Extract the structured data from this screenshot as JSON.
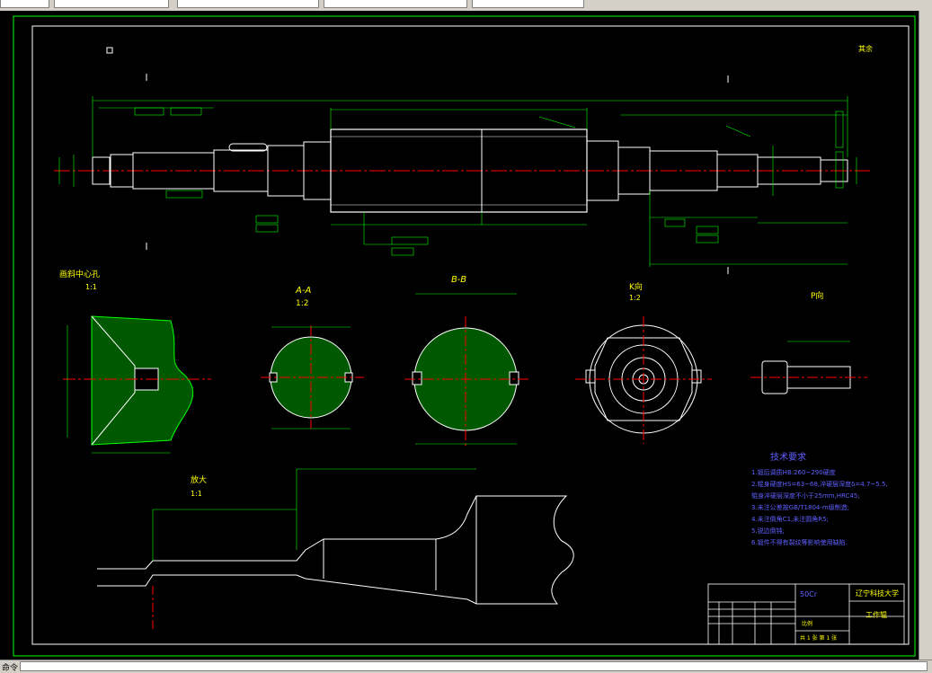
{
  "tabs": [
    {
      "label": "",
      "active": false
    },
    {
      "label": "",
      "active": false
    },
    {
      "label": "",
      "active": false
    },
    {
      "label": "",
      "active": false
    },
    {
      "label": "",
      "active": false
    }
  ],
  "status": {
    "prompt": "命令:"
  },
  "drawing": {
    "sections": {
      "center_hole": "画斜中心孔",
      "center_hole_scale": "1:1",
      "section_aa": "A-A",
      "section_aa_scale": "1:2",
      "section_bb": "B-B",
      "view_k": "K向",
      "view_k_scale": "1:2",
      "view_p": "P向",
      "enlarge": "放大",
      "enlarge_scale": "1:1"
    },
    "tech_requirements": {
      "title": "技术要求",
      "items": [
        "1.锻后调质HB:260~290硬度",
        "2.辊身硬度HS=63~68,淬硬层深度δ=4.7~5.5,",
        "   辊身淬硬层深度不小于25mm,HRC45;",
        "3.未注公差按GB/T1804-m级制造;",
        "4.未注倒角C1,未注圆角R5;",
        "5.锐边倒钝;",
        "6.锻件不得有裂纹等影响使用缺陷."
      ]
    },
    "title_block": {
      "school": "辽宁科技大学",
      "material": "50Cr",
      "drawing_name": "工作辊",
      "scale_label": "比例",
      "sheet": "共 1 张  第 1 张"
    },
    "roughness_note": "其余",
    "colors": {
      "background": "#000000",
      "outline": "#00ff00",
      "center": "#ff0000",
      "dims": "#00ff00",
      "text": "#ffff00",
      "note": "#6060ff",
      "hatch": "#00ff00",
      "white": "#ffffff"
    }
  }
}
